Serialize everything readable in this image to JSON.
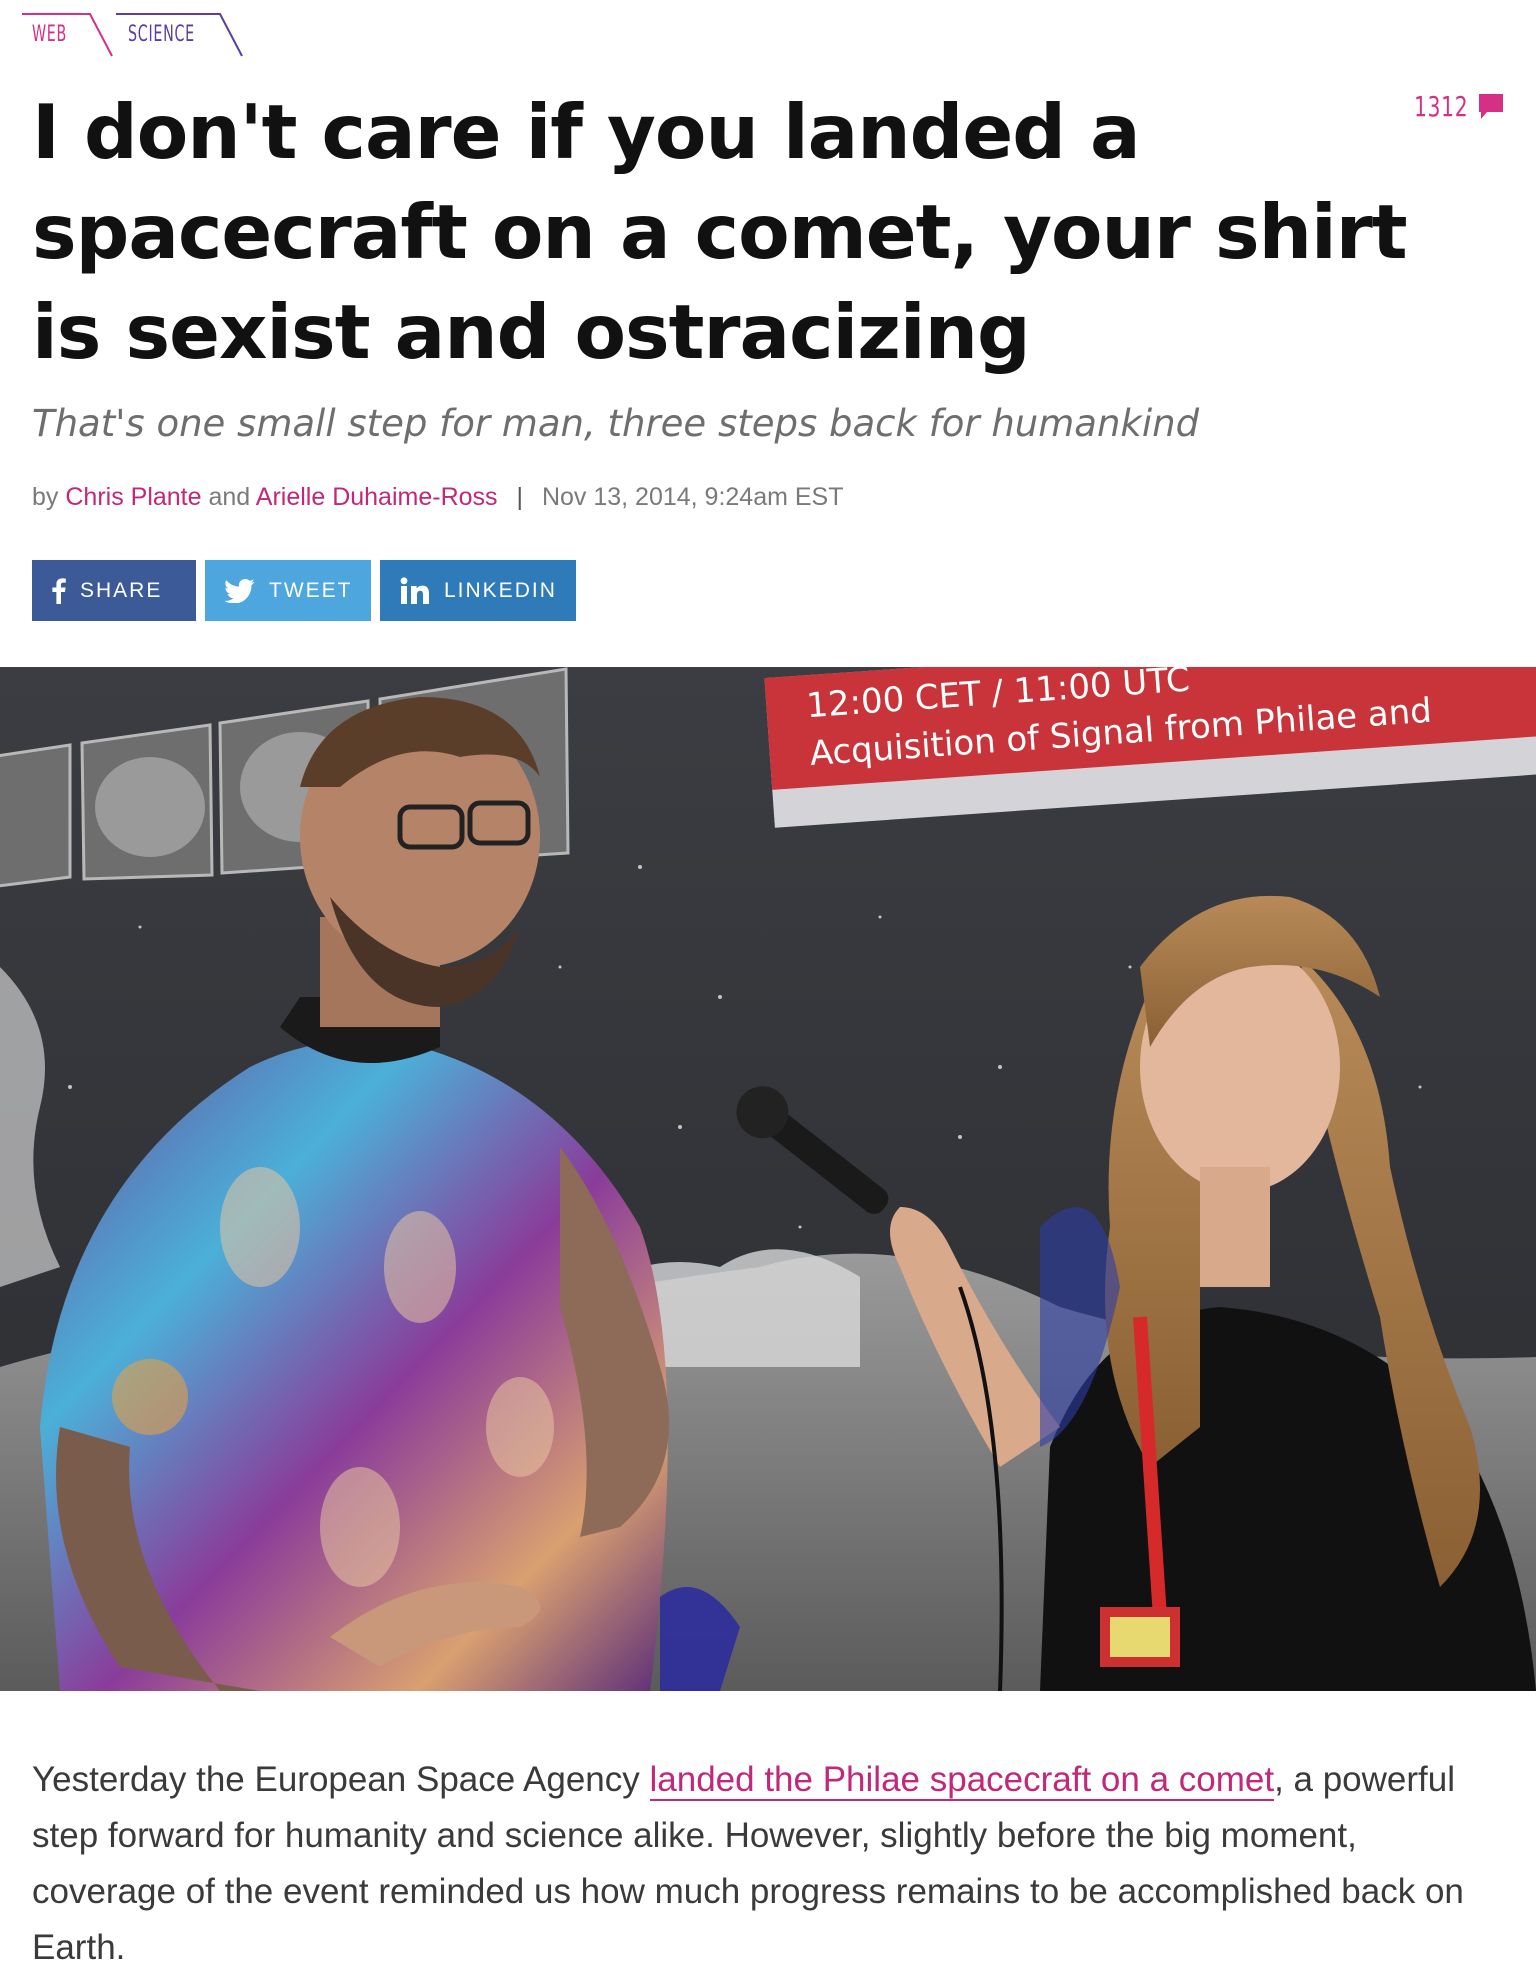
{
  "breadcrumb": {
    "items": [
      "WEB",
      "SCIENCE"
    ]
  },
  "comments": {
    "count": "1312",
    "icon": "comment-bubble-icon",
    "color": "#d62f86"
  },
  "article": {
    "title": "I don't care if you landed a spacecraft on a comet, your shirt is sexist and ostracizing",
    "subtitle": "That's one small step for man, three steps back for humankind",
    "byline": {
      "prefix": "by",
      "author1": "Chris Plante",
      "conjunction": "and",
      "author2": "Arielle Duhaime-Ross",
      "separator": "|",
      "date": "Nov 13, 2014, 9:24am EST"
    }
  },
  "share": {
    "facebook": {
      "label": "SHARE",
      "icon": "facebook-icon",
      "color": "#3d5a98"
    },
    "twitter": {
      "label": "TWEET",
      "icon": "twitter-icon",
      "color": "#4da7de"
    },
    "linkedin": {
      "label": "LINKEDIN",
      "icon": "linkedin-icon",
      "color": "#2f7ab8"
    }
  },
  "hero": {
    "screen_line1": "12:00 CET / 11:00 UTC",
    "screen_line2": "Acquisition of Signal from Philae and",
    "logo": "esa"
  },
  "body": {
    "p1_before": "Yesterday the European Space Agency ",
    "p1_link": "landed the Philae spacecraft on a comet",
    "p1_after": ", a powerful step forward for humanity and science alike. However, slightly before the big moment, coverage of the event reminded us how much progress remains to be accomplished back on Earth."
  },
  "colors": {
    "accent": "#d62f86",
    "secondary": "#5a3fa0"
  }
}
